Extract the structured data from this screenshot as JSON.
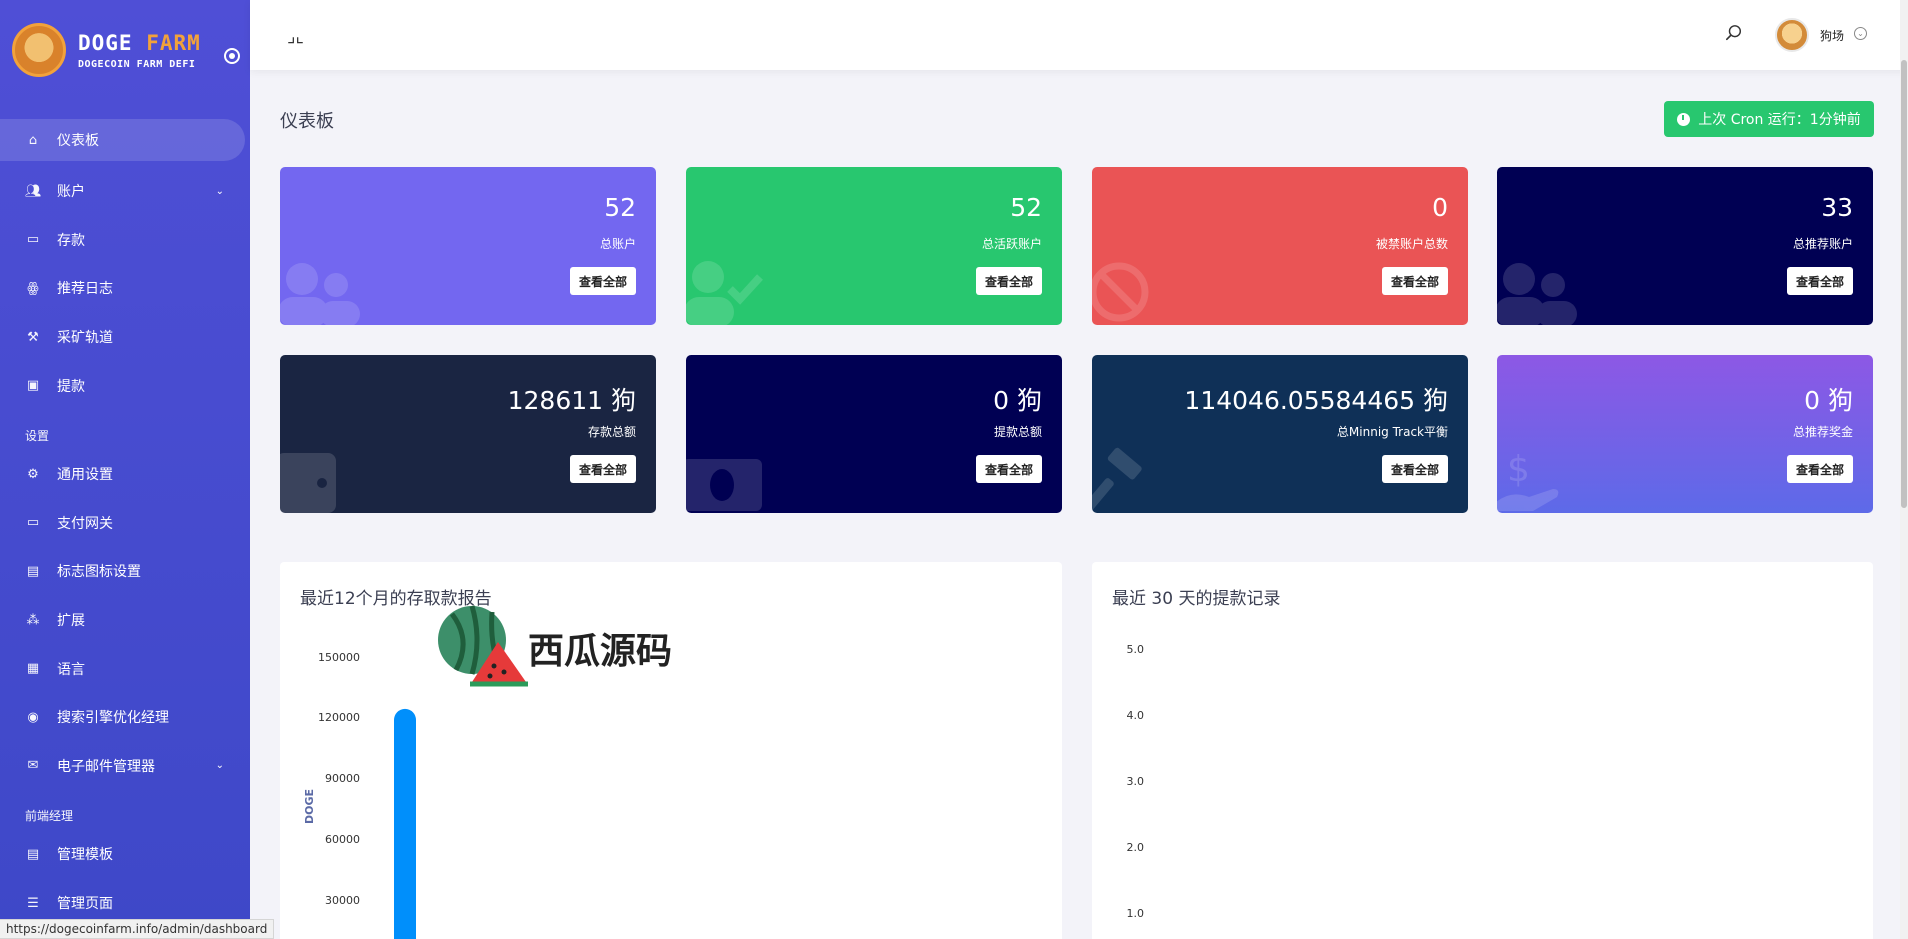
{
  "brand": {
    "title_part1": "DOGE",
    "title_part2": "FARM",
    "subtitle": "DOGECOIN FARM DEFI"
  },
  "sidebar": {
    "items": [
      {
        "label": "仪表板",
        "icon": "home-icon",
        "active": true
      },
      {
        "label": "账户",
        "icon": "users-icon",
        "has_caret": true
      },
      {
        "label": "存款",
        "icon": "wallet-icon"
      },
      {
        "label": "推荐日志",
        "icon": "referral-icon"
      },
      {
        "label": "采矿轨道",
        "icon": "hammer-icon"
      },
      {
        "label": "提款",
        "icon": "money-icon"
      }
    ],
    "section_settings": "设置",
    "settings_items": [
      {
        "label": "通用设置",
        "icon": "gear-icon"
      },
      {
        "label": "支付网关",
        "icon": "credit-card-icon"
      },
      {
        "label": "标志图标设置",
        "icon": "image-icon"
      },
      {
        "label": "扩展",
        "icon": "puzzle-icon"
      },
      {
        "label": "语言",
        "icon": "language-icon"
      },
      {
        "label": "搜索引擎优化经理",
        "icon": "globe-icon"
      },
      {
        "label": "电子邮件管理器",
        "icon": "envelope-icon",
        "has_caret": true
      }
    ],
    "section_frontend": "前端经理",
    "frontend_items": [
      {
        "label": "管理模板",
        "icon": "html-icon"
      },
      {
        "label": "管理页面",
        "icon": "list-icon"
      }
    ]
  },
  "topbar": {
    "username": "狗场"
  },
  "page": {
    "title": "仪表板",
    "cron_label": "上次 Cron 运行：1分钟前"
  },
  "cards": [
    {
      "value": "52",
      "label": "总账户",
      "button": "查看全部",
      "color": "#7367f0",
      "icon": "users-icon"
    },
    {
      "value": "52",
      "label": "总活跃账户",
      "button": "查看全部",
      "color": "#28c76f",
      "icon": "user-check-icon"
    },
    {
      "value": "0",
      "label": "被禁账户总数",
      "button": "查看全部",
      "color": "#ea5455",
      "icon": "ban-icon"
    },
    {
      "value": "33",
      "label": "总推荐账户",
      "button": "查看全部",
      "color": "#000053",
      "icon": "users-icon"
    },
    {
      "value": "128611 狗",
      "label": "存款总额",
      "button": "查看全部",
      "color": "#1a2542",
      "icon": "wallet-icon"
    },
    {
      "value": "0 狗",
      "label": "提款总额",
      "button": "查看全部",
      "color": "#000053",
      "icon": "money-icon"
    },
    {
      "value": "114046.05584465 狗",
      "label": "总Minnig Track平衡",
      "button": "查看全部",
      "color": "#0f3057",
      "icon": "hammer-icon"
    },
    {
      "value": "0 狗",
      "label": "总推荐奖金",
      "button": "查看全部",
      "color": "#8d58e5",
      "icon": "hand-dollar-icon"
    }
  ],
  "chart_data": [
    {
      "type": "bar",
      "title": "最近12个月的存取款报告",
      "ylabel": "DOGE",
      "yticks": [
        "150000",
        "120000",
        "90000",
        "60000",
        "30000"
      ],
      "ylim": [
        0,
        150000
      ],
      "series": [
        {
          "values": [
            128611
          ],
          "color": "#008ffb"
        }
      ]
    },
    {
      "type": "line",
      "title": "最近 30 天的提款记录",
      "yticks": [
        "5.0",
        "4.0",
        "3.0",
        "2.0",
        "1.0"
      ],
      "ylim": [
        0,
        5
      ]
    }
  ],
  "watermark": {
    "text": "西瓜源码"
  },
  "status_url": "https://dogecoinfarm.info/admin/dashboard"
}
